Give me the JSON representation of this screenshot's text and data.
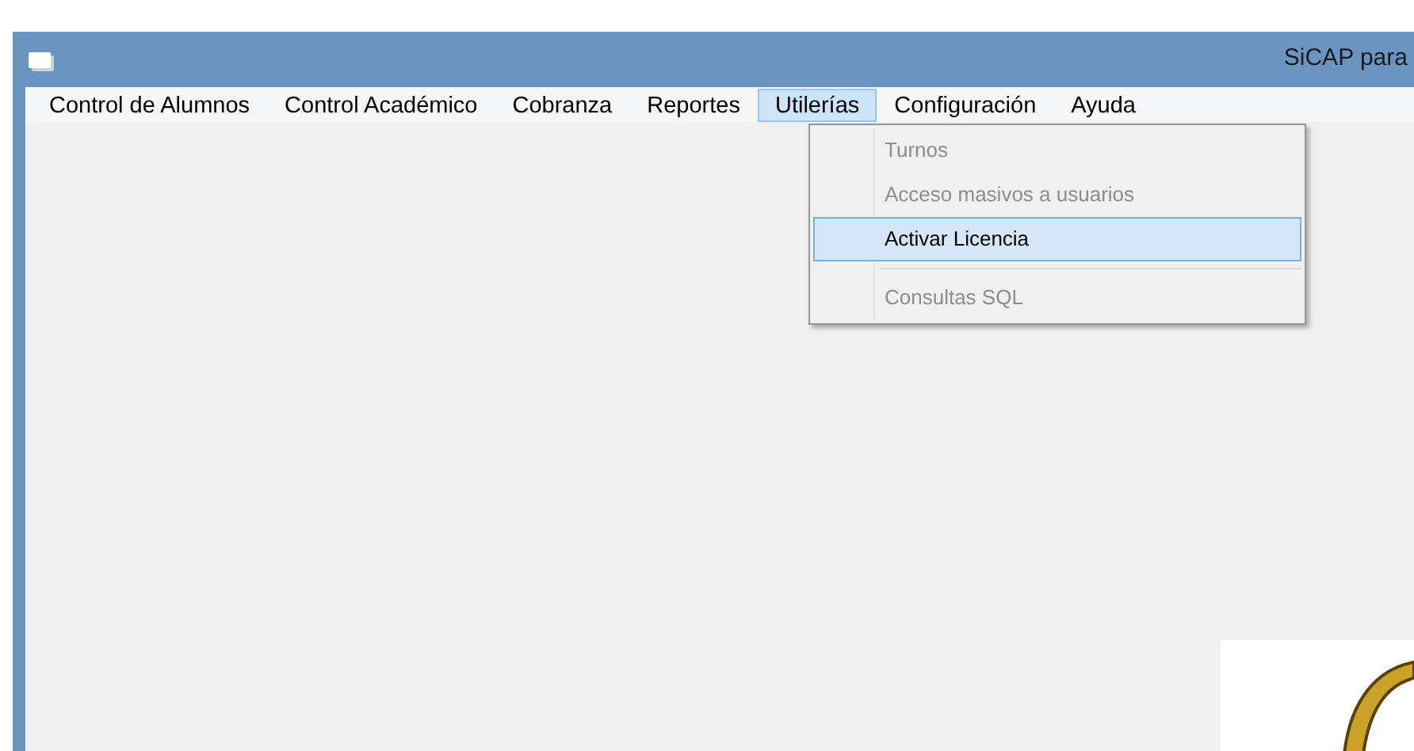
{
  "window": {
    "title": "SiCAP para"
  },
  "menu_bar": [
    {
      "label": "Control de Alumnos",
      "selected": false
    },
    {
      "label": "Control Académico",
      "selected": false
    },
    {
      "label": "Cobranza",
      "selected": false
    },
    {
      "label": "Reportes",
      "selected": false
    },
    {
      "label": "Utilerías",
      "selected": true
    },
    {
      "label": "Configuración",
      "selected": false
    },
    {
      "label": "Ayuda",
      "selected": false
    }
  ],
  "dropdown": [
    {
      "kind": "item",
      "label": "Turnos",
      "disabled": true,
      "selected": false
    },
    {
      "kind": "item",
      "label": "Acceso masivos a usuarios",
      "disabled": true,
      "selected": false
    },
    {
      "kind": "item",
      "label": "Activar Licencia",
      "disabled": false,
      "selected": true
    },
    {
      "kind": "separator"
    },
    {
      "kind": "item",
      "label": "Consultas SQL",
      "disabled": true,
      "selected": false
    }
  ]
}
